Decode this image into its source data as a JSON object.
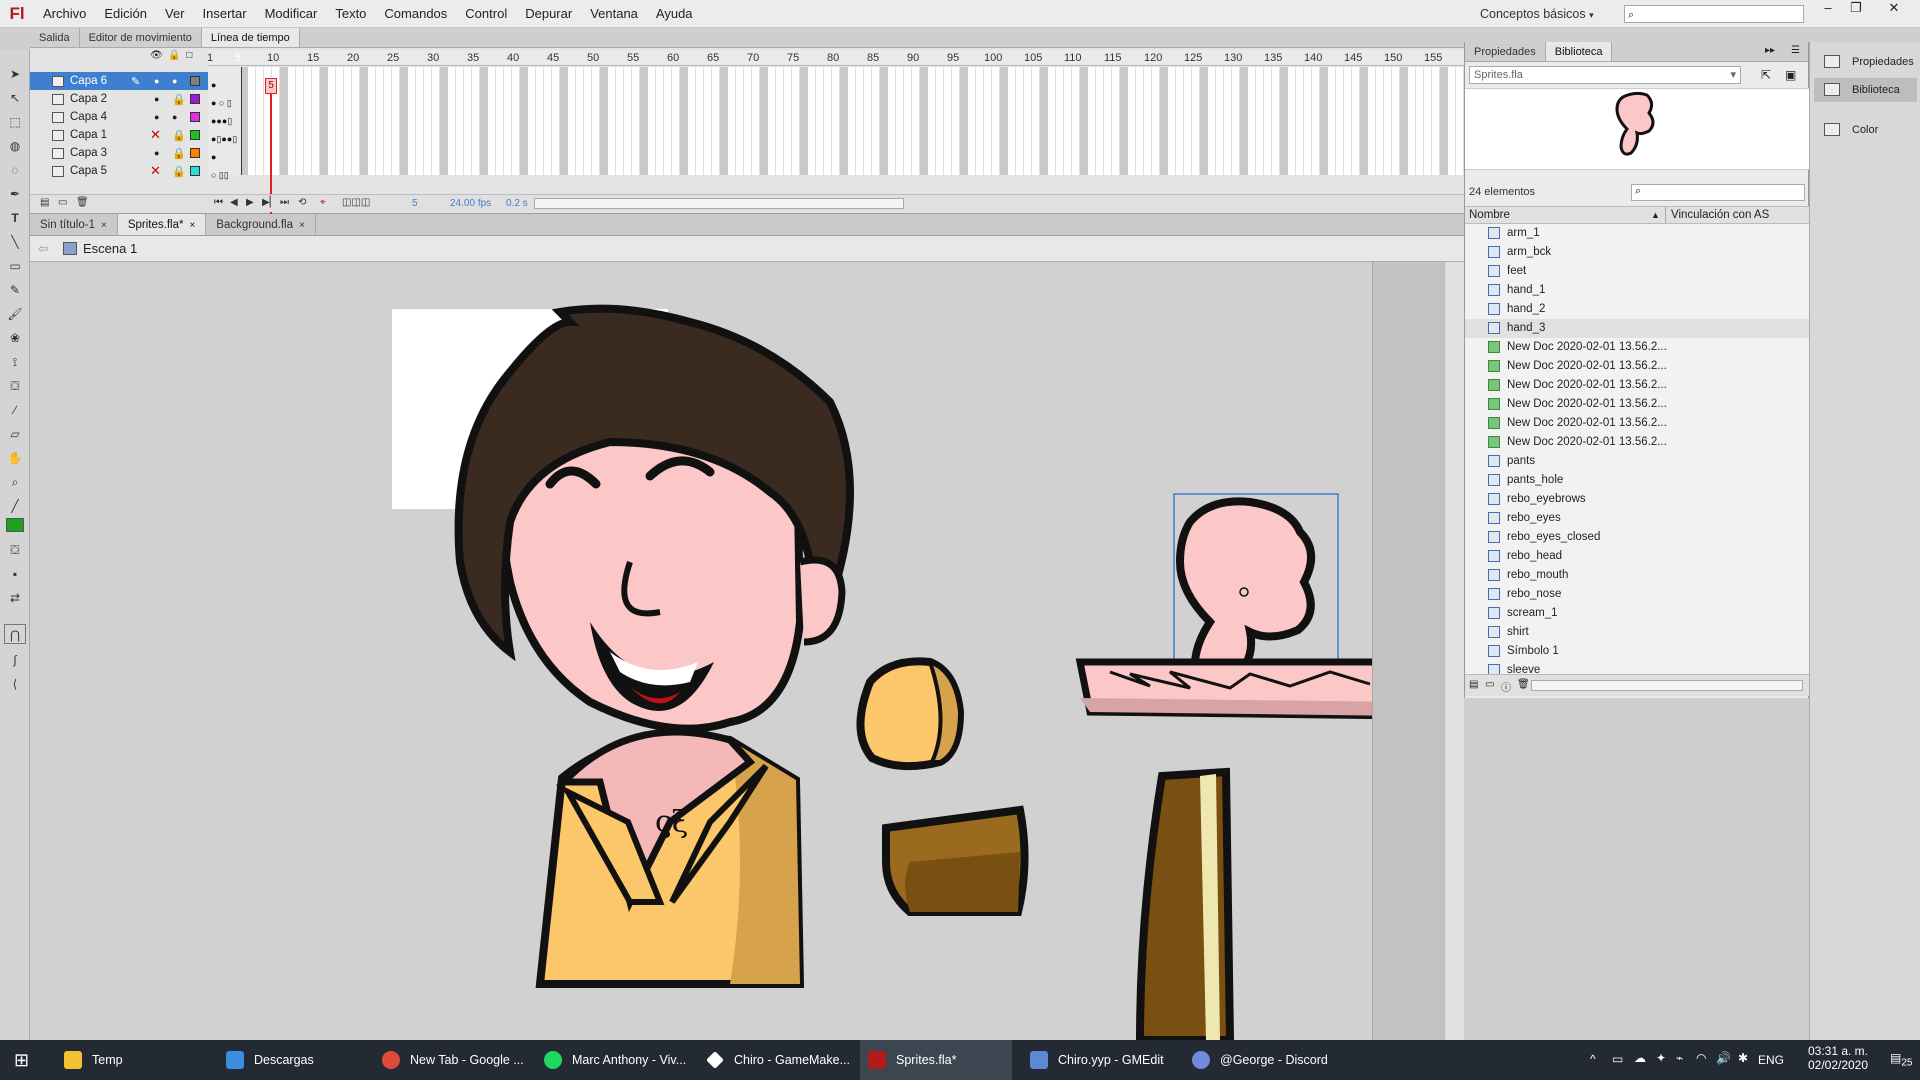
{
  "app": {
    "logo": "Fl"
  },
  "menu": [
    "Archivo",
    "Edición",
    "Ver",
    "Insertar",
    "Modificar",
    "Texto",
    "Comandos",
    "Control",
    "Depurar",
    "Ventana",
    "Ayuda"
  ],
  "workspace": "Conceptos básicos",
  "workspace_icon": "chevron-down-icon",
  "panel_tabs": [
    "Salida",
    "Editor de movimiento",
    "Línea de tiempo"
  ],
  "layers": [
    {
      "name": "Capa 6",
      "color": "#7f7f7f",
      "selected": true
    },
    {
      "name": "Capa 2",
      "color": "#9b1fd1"
    },
    {
      "name": "Capa 4",
      "color": "#e02ee0"
    },
    {
      "name": "Capa 1",
      "color": "#1fbf1f",
      "hidden": true
    },
    {
      "name": "Capa 3",
      "color": "#ff7f00"
    },
    {
      "name": "Capa 5",
      "color": "#2ed9d9",
      "hidden": true
    }
  ],
  "frame_ticks": [
    "1",
    "5",
    "10",
    "15",
    "20",
    "25",
    "30",
    "35",
    "40",
    "45",
    "50",
    "55",
    "60",
    "65",
    "70",
    "75",
    "80",
    "85",
    "90",
    "95",
    "100",
    "105",
    "110",
    "115",
    "120",
    "125",
    "130",
    "135",
    "140",
    "145",
    "150",
    "155"
  ],
  "playhead_frame": "5",
  "timeline_footer": {
    "frame": "5",
    "fps": "24.00",
    "fps_unit": "fps",
    "time": "0.2 s"
  },
  "doc_tabs": [
    {
      "label": "Sin título-1",
      "close": "×"
    },
    {
      "label": "Sprites.fla*",
      "close": "×",
      "active": true
    },
    {
      "label": "Background.fla",
      "close": "×"
    }
  ],
  "scene": "Escena 1",
  "library": {
    "tabs": [
      "Propiedades",
      "Biblioteca"
    ],
    "file": "Sprites.fla",
    "count": "24 elementos",
    "col_name": "Nombre",
    "col_linkage": "Vinculación con AS",
    "items": [
      {
        "name": "arm_1",
        "kind": "graphic"
      },
      {
        "name": "arm_bck",
        "kind": "graphic"
      },
      {
        "name": "feet",
        "kind": "graphic"
      },
      {
        "name": "hand_1",
        "kind": "graphic"
      },
      {
        "name": "hand_2",
        "kind": "graphic"
      },
      {
        "name": "hand_3",
        "kind": "graphic",
        "selected": true
      },
      {
        "name": "New Doc 2020-02-01 13.56.2...",
        "kind": "bitmap"
      },
      {
        "name": "New Doc 2020-02-01 13.56.2...",
        "kind": "bitmap"
      },
      {
        "name": "New Doc 2020-02-01 13.56.2...",
        "kind": "bitmap"
      },
      {
        "name": "New Doc 2020-02-01 13.56.2...",
        "kind": "bitmap"
      },
      {
        "name": "New Doc 2020-02-01 13.56.2...",
        "kind": "bitmap"
      },
      {
        "name": "New Doc 2020-02-01 13.56.2...",
        "kind": "bitmap"
      },
      {
        "name": "pants",
        "kind": "graphic"
      },
      {
        "name": "pants_hole",
        "kind": "graphic"
      },
      {
        "name": "rebo_eyebrows",
        "kind": "graphic"
      },
      {
        "name": "rebo_eyes",
        "kind": "graphic"
      },
      {
        "name": "rebo_eyes_closed",
        "kind": "graphic"
      },
      {
        "name": "rebo_head",
        "kind": "graphic"
      },
      {
        "name": "rebo_mouth",
        "kind": "graphic"
      },
      {
        "name": "rebo_nose",
        "kind": "graphic"
      },
      {
        "name": "scream_1",
        "kind": "graphic"
      },
      {
        "name": "shirt",
        "kind": "graphic"
      },
      {
        "name": "Símbolo 1",
        "kind": "graphic"
      },
      {
        "name": "sleeve",
        "kind": "graphic"
      }
    ]
  },
  "dock": [
    "Propiedades",
    "Biblioteca",
    "Color"
  ],
  "taskbar": {
    "items": [
      {
        "label": "Temp",
        "color": "#f2c232"
      },
      {
        "label": "Descargas",
        "color": "#3b8de0"
      },
      {
        "label": "New Tab - Google ...",
        "color": "#e04a3a"
      },
      {
        "label": "Marc Anthony - Viv...",
        "color": "#1ed760"
      },
      {
        "label": "Chiro - GameMake...",
        "color": "#ffffff"
      },
      {
        "label": "Sprites.fla*",
        "color": "#b01c1c",
        "active": true
      },
      {
        "label": "Chiro.yyp - GMEdit",
        "color": "#5a8ad6"
      },
      {
        "label": "@George - Discord",
        "color": "#7289da"
      }
    ],
    "lang": "ENG",
    "time": "03:31 a. m.",
    "date": "02/02/2020",
    "notif": "25"
  },
  "colors": {
    "selection": "#3e7fcf",
    "accent": "#e02020",
    "skin": "#fcc7c7",
    "shirt": "#fcc66a",
    "hair": "#3a2a1f"
  }
}
